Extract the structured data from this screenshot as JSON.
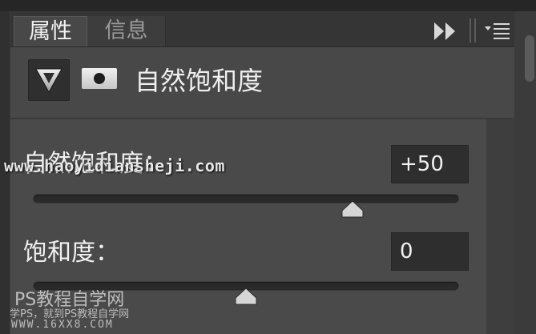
{
  "tabs": [
    {
      "label": "属性",
      "active": true
    },
    {
      "label": "信息",
      "active": false
    }
  ],
  "header": {
    "title": "自然饱和度"
  },
  "sliders": [
    {
      "label": "自然饱和度：",
      "value": "+50",
      "numeric": 50,
      "min": -100,
      "max": 100
    },
    {
      "label": "饱和度：",
      "value": "0",
      "numeric": 0,
      "min": -100,
      "max": 100
    }
  ],
  "watermarks": {
    "url": "www.haoyidiansheji.com",
    "brand": "PS教程自学网",
    "sub": "学PS，就到PS教程自学网",
    "domain": "WWW.16XX8.COM"
  },
  "icons": {
    "collapse": "double-chevron-right-icon",
    "menu": "panel-menu-icon",
    "adjustment": "vibrance-triangle-icon",
    "mask": "layer-mask-icon"
  },
  "colors": {
    "panel": "#484848",
    "tab_bar": "#353535",
    "field": "#2e2e2e",
    "text": "#f0f0f0"
  }
}
